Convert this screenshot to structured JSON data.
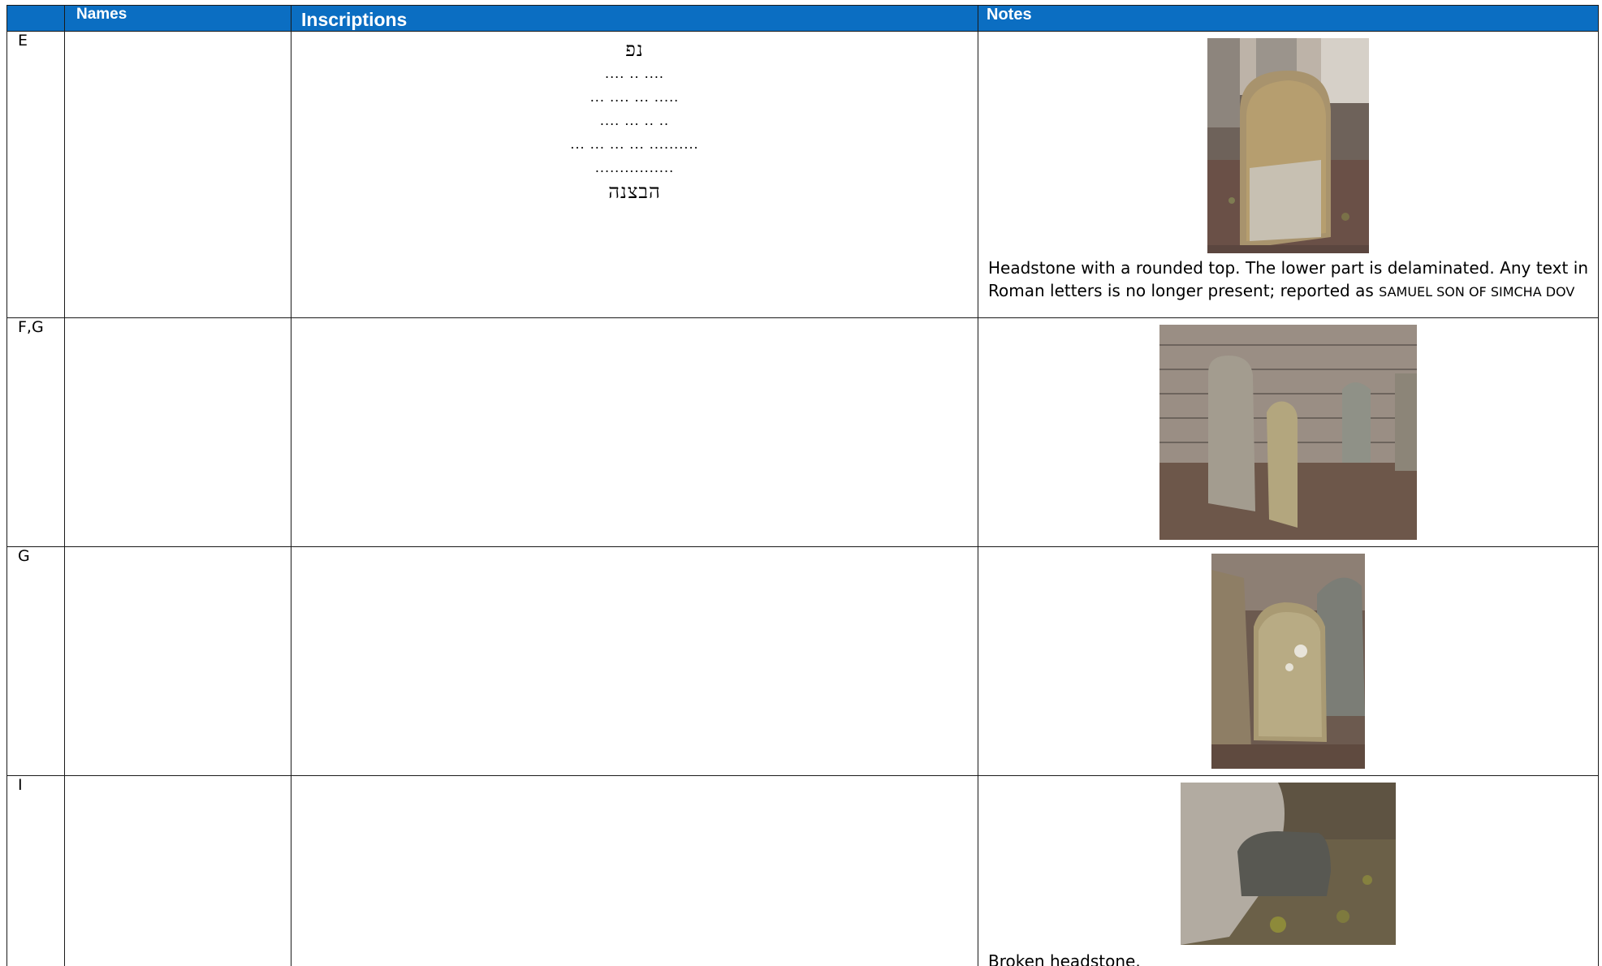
{
  "header": {
    "names": "Names",
    "inscriptions": "Inscriptions",
    "notes": "Notes"
  },
  "rows": [
    {
      "id": "E",
      "inscription_lines": [
        "נפ",
        ".... .. ....",
        "... .... ... .....",
        ".... ... .. ..",
        "... ... ... ... ..........",
        "................",
        "הבצנה"
      ],
      "note_main": "Headstone with a rounded top. The lower part is delaminated. Any text in Roman letters is no longer present; reported as ",
      "note_caps": "SAMUEL SON OF SIMCHA DOV"
    },
    {
      "id": "F,G"
    },
    {
      "id": "G"
    },
    {
      "id": "I",
      "note_main": "Broken headstone."
    }
  ]
}
